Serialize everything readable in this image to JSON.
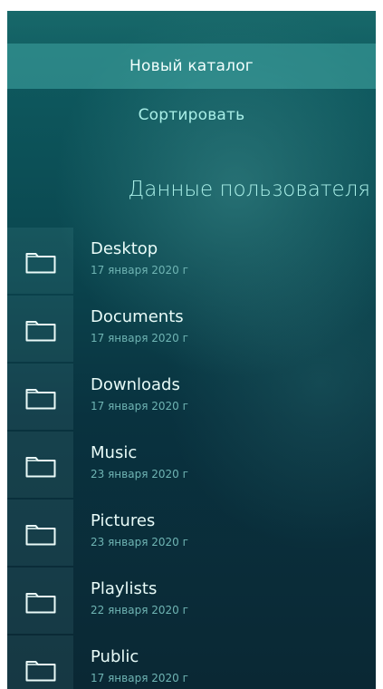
{
  "pulley_menu": {
    "items": [
      {
        "label": "Новый каталог"
      },
      {
        "label": "Сортировать"
      }
    ]
  },
  "header": {
    "title": "Данные пользователя"
  },
  "files": [
    {
      "name": "Desktop",
      "date": "17 января 2020 г",
      "icon": "folder-icon"
    },
    {
      "name": "Documents",
      "date": "17 января 2020 г",
      "icon": "folder-icon"
    },
    {
      "name": "Downloads",
      "date": "17 января 2020 г",
      "icon": "folder-icon"
    },
    {
      "name": "Music",
      "date": "23 января 2020 г",
      "icon": "folder-icon"
    },
    {
      "name": "Pictures",
      "date": "23 января 2020 г",
      "icon": "folder-icon"
    },
    {
      "name": "Playlists",
      "date": "22 января 2020 г",
      "icon": "folder-icon"
    },
    {
      "name": "Public",
      "date": "17 января 2020 г",
      "icon": "folder-icon"
    }
  ],
  "colors": {
    "highlight": "#44aaa5",
    "primary_text": "#e8fbf8",
    "secondary_text": "#a9efe8",
    "date_text": "#6fb4b3"
  }
}
